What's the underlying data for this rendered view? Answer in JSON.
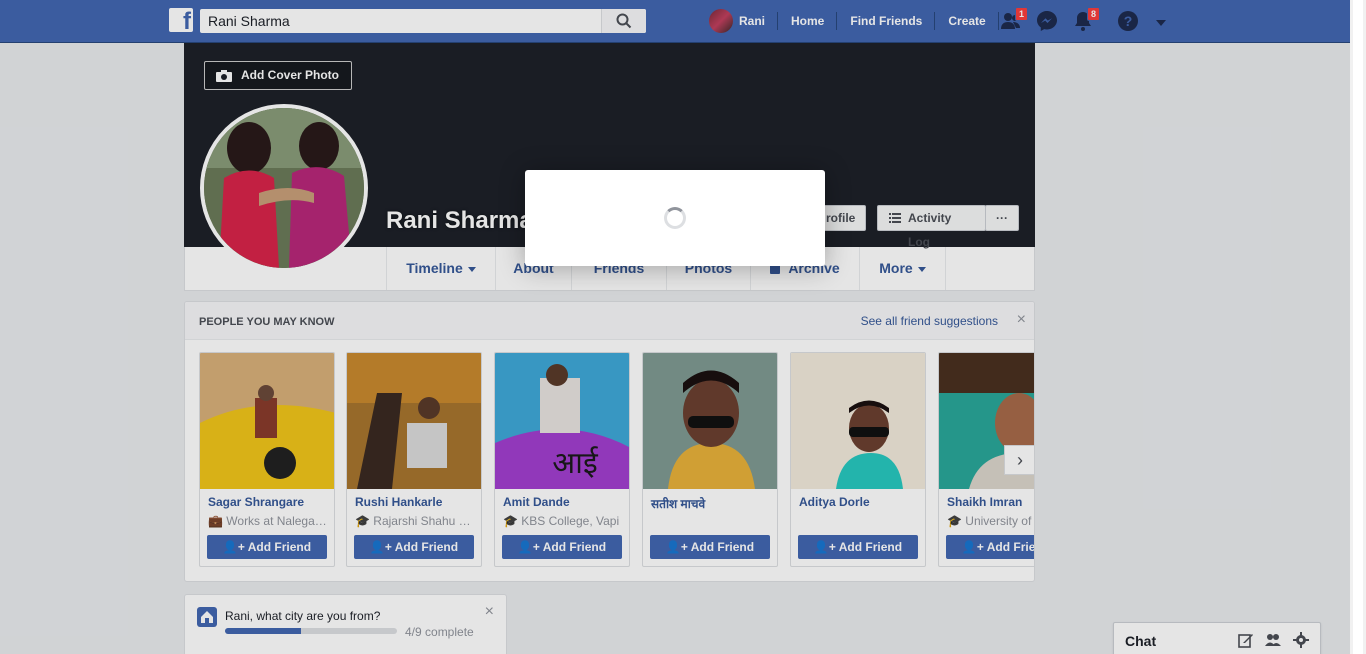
{
  "topbar": {
    "logo": "f",
    "search_value": "Rani Sharma",
    "user_name": "Rani",
    "nav": [
      "Home",
      "Find Friends",
      "Create"
    ],
    "friend_requests_badge": "1",
    "notifications_badge": "8"
  },
  "cover": {
    "add_cover_label": "Add Cover Photo",
    "profile_name": "Rani Sharma",
    "update_info_label": "rofile",
    "activity_log_label": "Activity Log",
    "more_dots": "···"
  },
  "tabs": [
    "Timeline",
    "About",
    "Friends",
    "Photos",
    "Archive",
    "More"
  ],
  "pymk": {
    "title": "PEOPLE YOU MAY KNOW",
    "see_all": "See all friend suggestions",
    "close": "×",
    "add_label": "Add Friend",
    "people": [
      {
        "name": "Sagar Shrangare",
        "info": "Works at Nalegaon Fort"
      },
      {
        "name": "Rushi Hankarle",
        "info": "Rajarshi Shahu College"
      },
      {
        "name": "Amit Dande",
        "info": "KBS College, Vapi"
      },
      {
        "name": "सतीश माचवे",
        "info": ""
      },
      {
        "name": "Aditya Dorle",
        "info": ""
      },
      {
        "name": "Shaikh Imran",
        "info": "University of Pune"
      }
    ],
    "next": "›"
  },
  "city": {
    "question": "Rani, what city are you from?",
    "progress_text": "4/9 complete",
    "progress": 0.44,
    "close": "×"
  },
  "chat": {
    "label": "Chat"
  },
  "colors": {
    "brand": "#4267b2",
    "link": "#365899",
    "badge": "#fa3e3e"
  }
}
